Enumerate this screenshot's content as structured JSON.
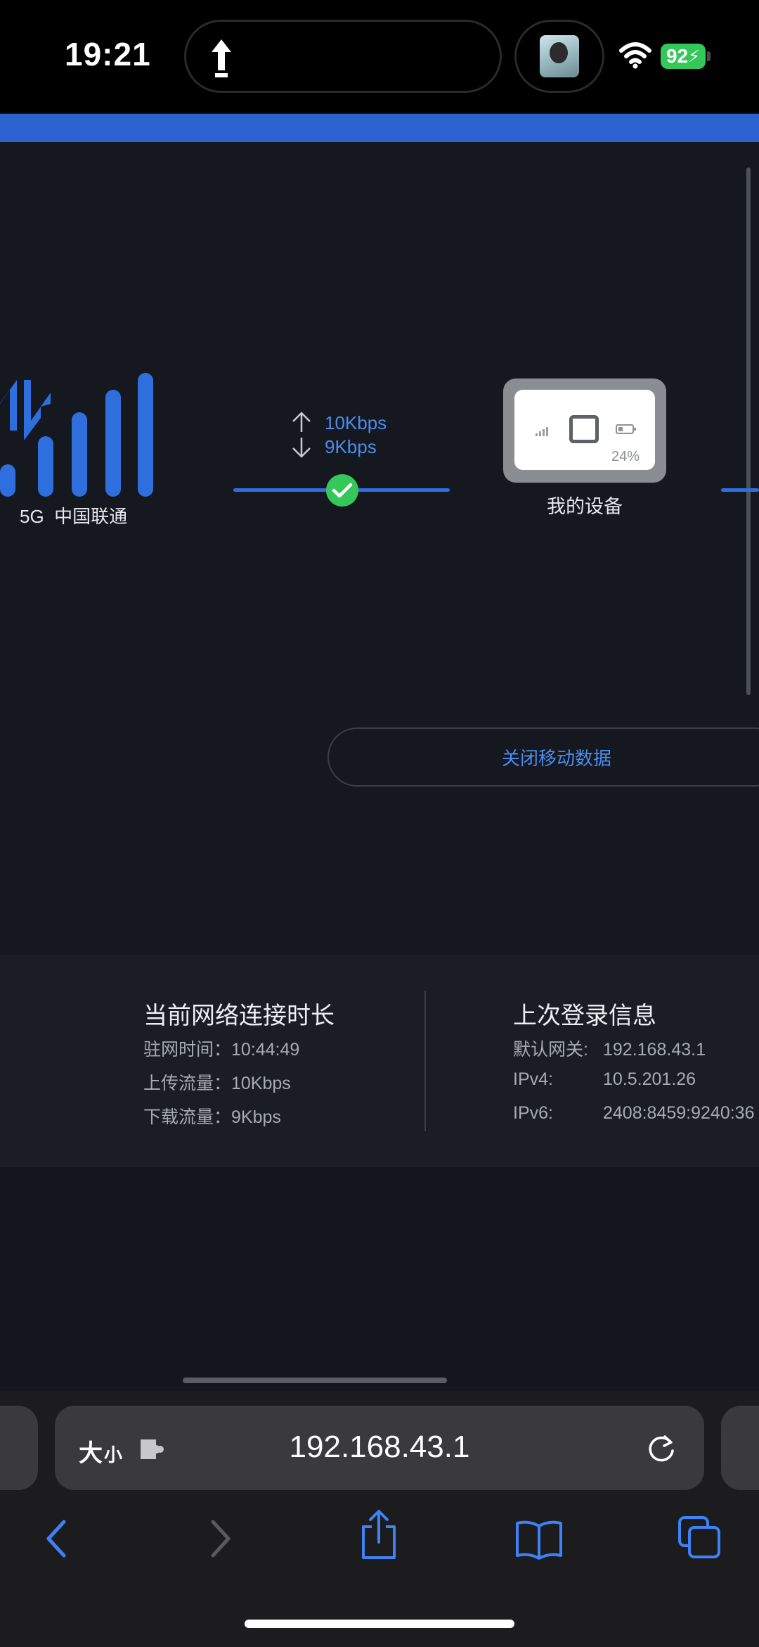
{
  "status_bar": {
    "time": "19:21",
    "battery_level": "92",
    "colors": {
      "battery": "#34c759"
    },
    "icons": [
      "upload-arrow-icon",
      "album-art-icon",
      "wifi-icon",
      "charging-battery-icon"
    ]
  },
  "network": {
    "carrier": "5G  中国联通",
    "rate": {
      "up": "10Kbps",
      "down": "9Kbps"
    },
    "device": {
      "label": "我的设备",
      "battery": "24%"
    },
    "close_data_label": "关闭移动数据",
    "colors": {
      "accent": "#2f6fdd",
      "link_text": "#4b8df0",
      "connected": "#34c759"
    }
  },
  "info": {
    "duration": {
      "title": "当前网络连接时长",
      "dwell": "驻网时间：10:44:49",
      "upload": "上传流量：10Kbps",
      "download": "下载流量：9Kbps"
    },
    "login": {
      "title": "上次登录信息",
      "gateway_key": "默认网关:",
      "gateway_value": "192.168.43.1",
      "ipv4_key": "IPv4:",
      "ipv4_value": "10.5.201.26",
      "ipv6_key": "IPv6:",
      "ipv6_value": "2408:8459:9240:36"
    }
  },
  "browser": {
    "text_size_big": "大",
    "text_size_small": "小",
    "url": "192.168.43.1",
    "icons": [
      "extension-icon",
      "reload-icon",
      "back-icon",
      "forward-icon",
      "share-icon",
      "bookmarks-icon",
      "tabs-icon"
    ]
  }
}
